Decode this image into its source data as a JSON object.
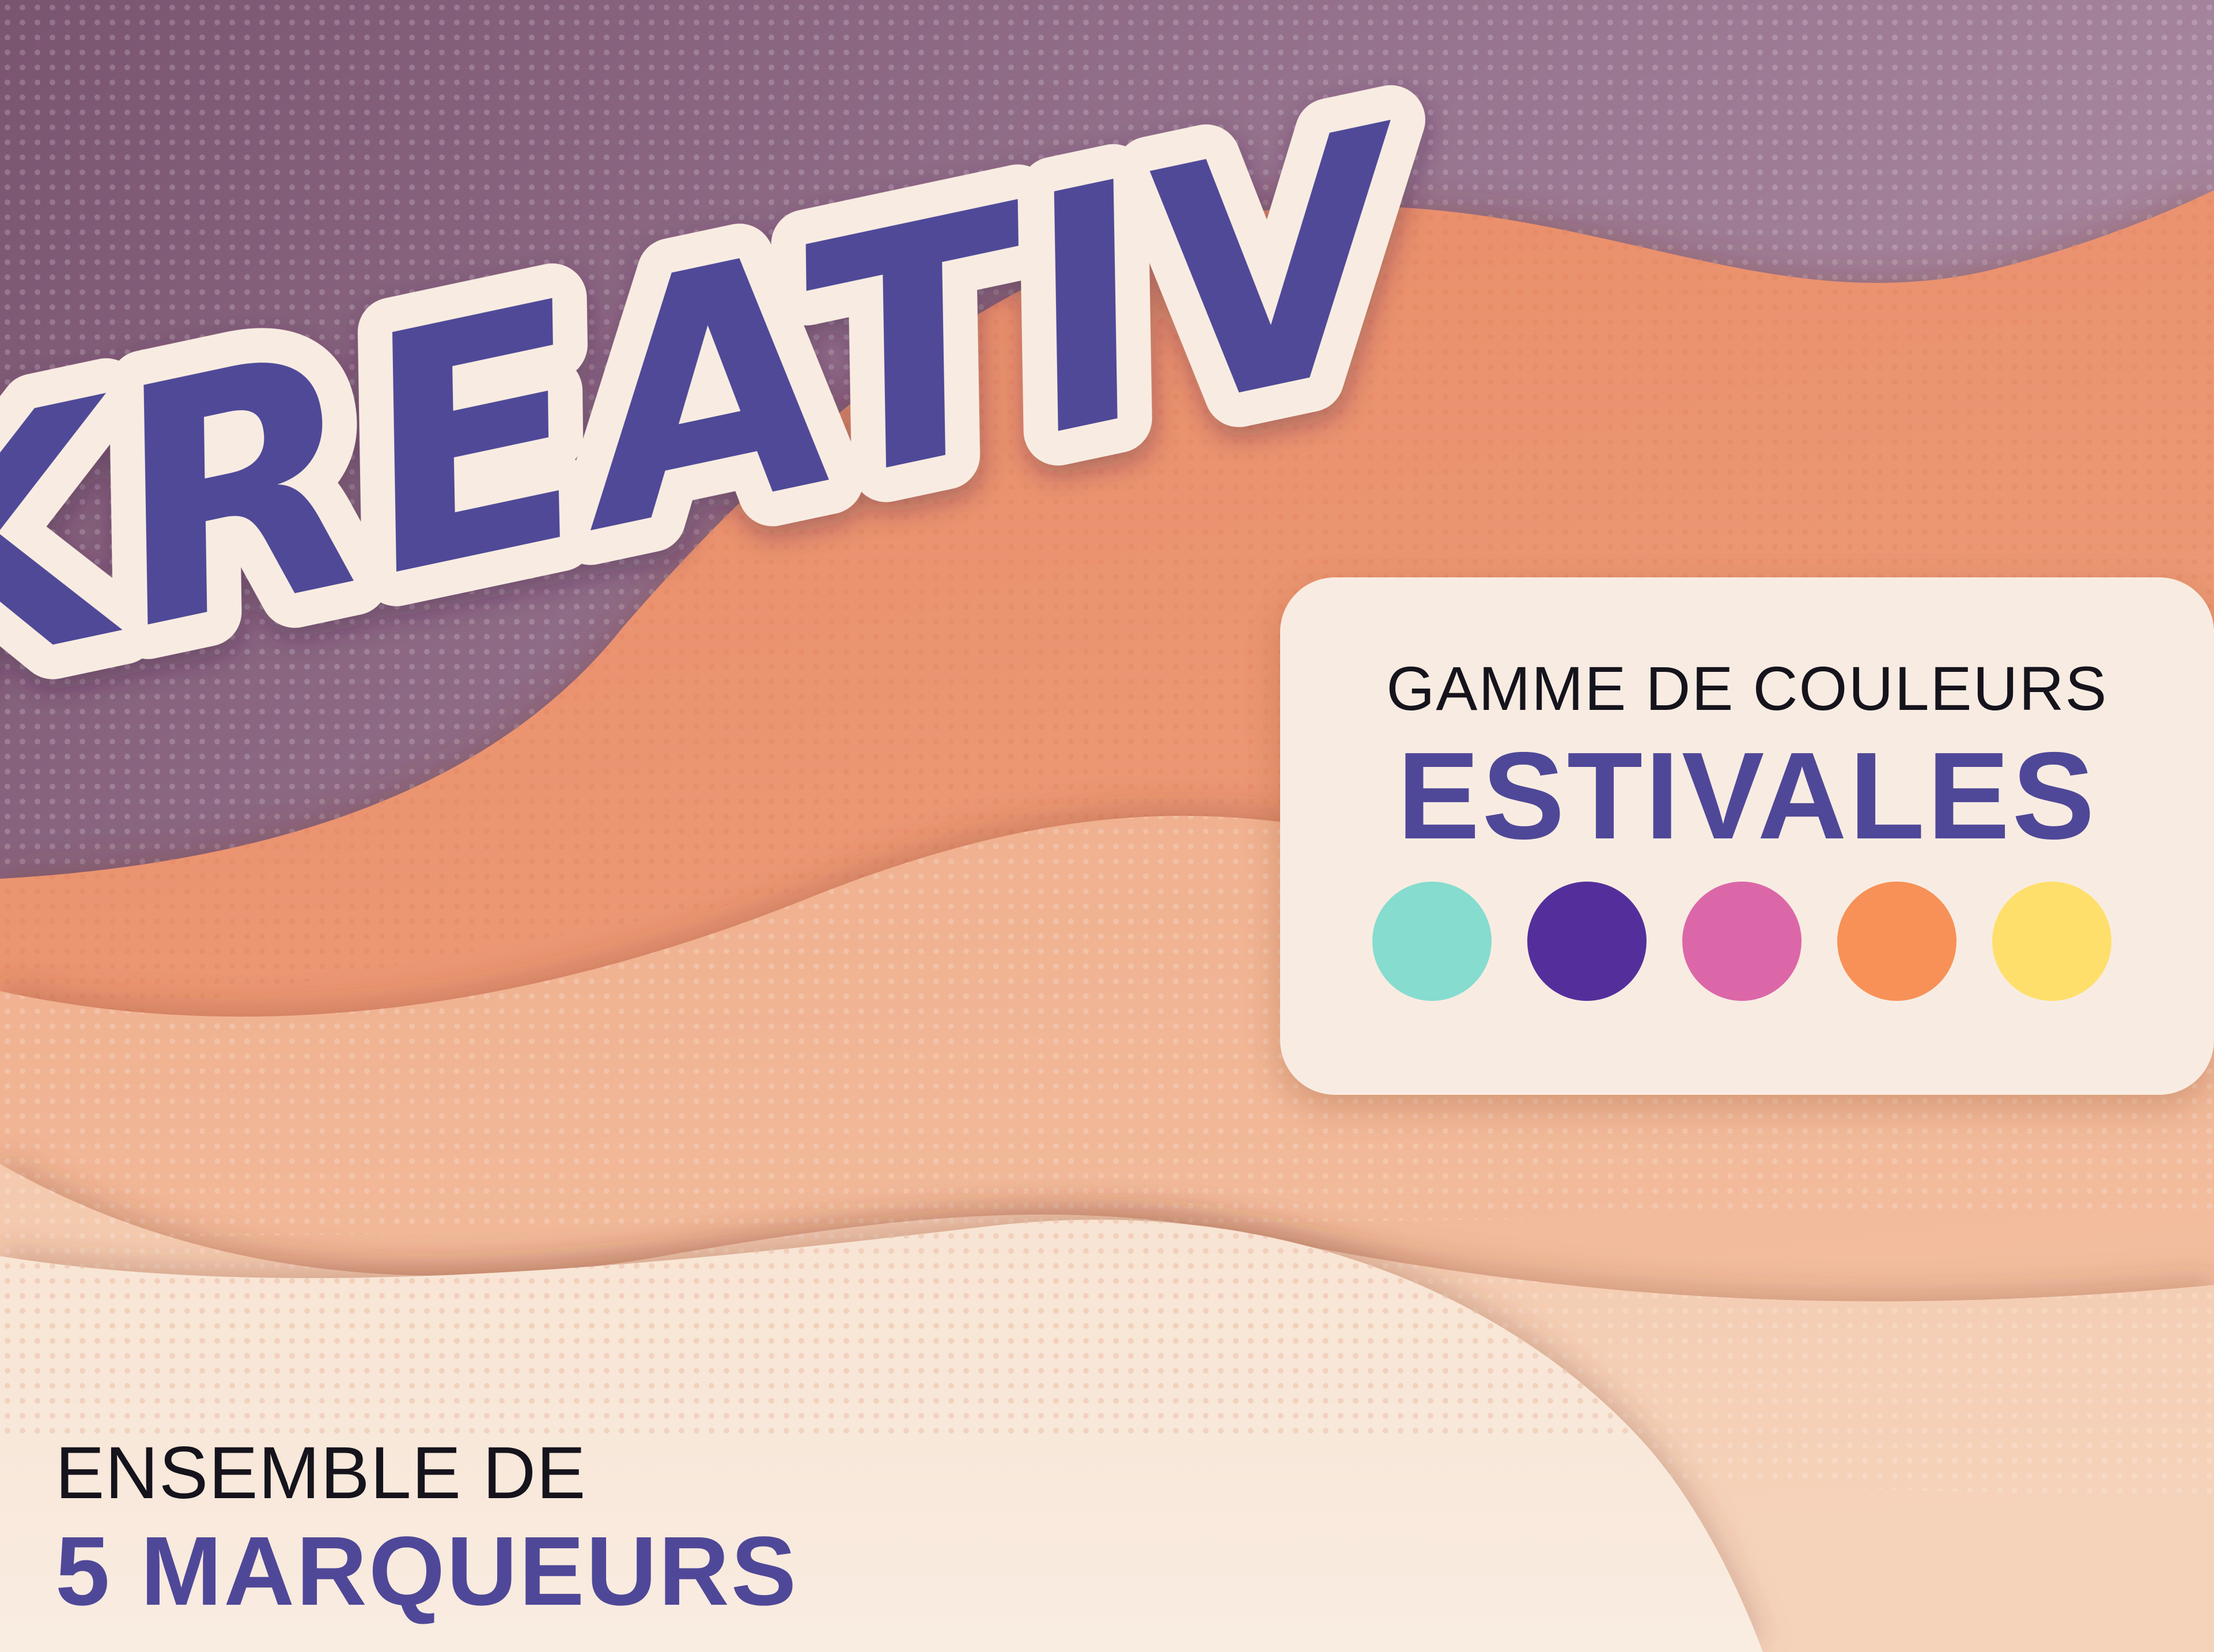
{
  "brand": {
    "logo_text": "KREATIV",
    "logo_color": "#4f4898",
    "logo_outline_color": "#f8ece2"
  },
  "palette_card": {
    "subtitle": "GAMME DE COULEURS",
    "title": "ESTIVALES",
    "swatches": [
      {
        "name": "turquoise",
        "color": "#86dccf"
      },
      {
        "name": "purple",
        "color": "#542f9b"
      },
      {
        "name": "pink",
        "color": "#dc67a8"
      },
      {
        "name": "orange",
        "color": "#f79157"
      },
      {
        "name": "yellow",
        "color": "#ffdf6b"
      }
    ]
  },
  "set_info": {
    "subtitle": "ENSEMBLE DE",
    "title": "5 MARQUEURS"
  },
  "background": {
    "colors": [
      "#7d5974",
      "#a07e95",
      "#e8906c",
      "#f0b495",
      "#f4cdb3",
      "#f7e9dc"
    ]
  }
}
